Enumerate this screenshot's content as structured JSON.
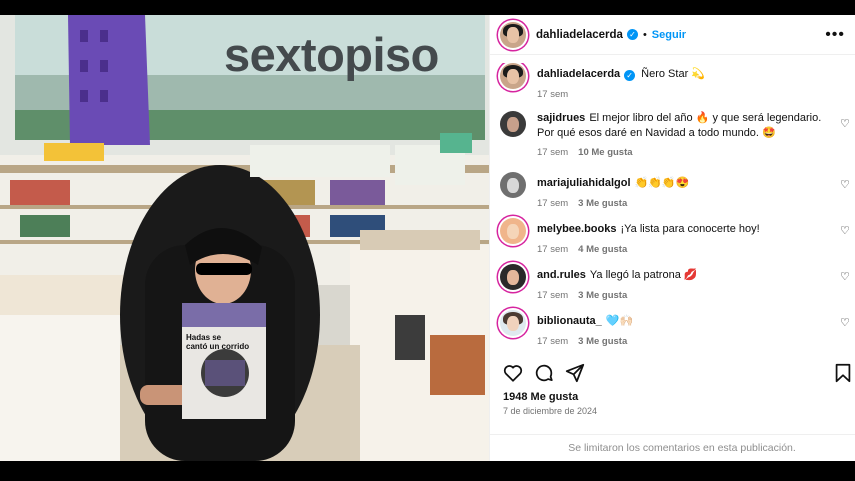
{
  "post": {
    "author": "dahliadelacerda",
    "follow_label": "Seguir",
    "separator": "•",
    "more_label": "•••",
    "photo": {
      "store_sign": "sextopiso",
      "book_title_line1": "Hadas se",
      "book_title_line2": "cantó un corrido"
    }
  },
  "caption": {
    "author": "dahliadelacerda",
    "text": "Ñero Star 💫",
    "time": "17 sem"
  },
  "comments": [
    {
      "user": "sajidrues",
      "text": "El mejor libro del año 🔥 y que será legendario. Por qué esos daré en Navidad a todo mundo. 🤩",
      "time": "17 sem",
      "likes": "10 Me gusta"
    },
    {
      "user": "mariajuliahidalgol",
      "text": "👏👏👏😍",
      "time": "17 sem",
      "likes": "3 Me gusta"
    },
    {
      "user": "melybee.books",
      "text": "¡Ya lista para conocerte hoy!",
      "time": "17 sem",
      "likes": "4 Me gusta"
    },
    {
      "user": "and.rules",
      "text": "Ya llegó la patrona 💋",
      "time": "17 sem",
      "likes": "3 Me gusta"
    },
    {
      "user": "biblionauta_",
      "text": "🩵🙌🏻",
      "time": "17 sem",
      "likes": "3 Me gusta"
    }
  ],
  "footer": {
    "likes_total": "1948 Me gusta",
    "date": "7 de diciembre de 2024",
    "comments_disabled": "Se limitaron los comentarios en esta publicación."
  },
  "icons": {
    "like": "heart-icon",
    "comment": "comment-icon",
    "share": "send-icon",
    "save": "bookmark-icon"
  },
  "colors": {
    "accent": "#0095f6",
    "story_ring": "#d6249f",
    "muted_text": "#737373"
  }
}
